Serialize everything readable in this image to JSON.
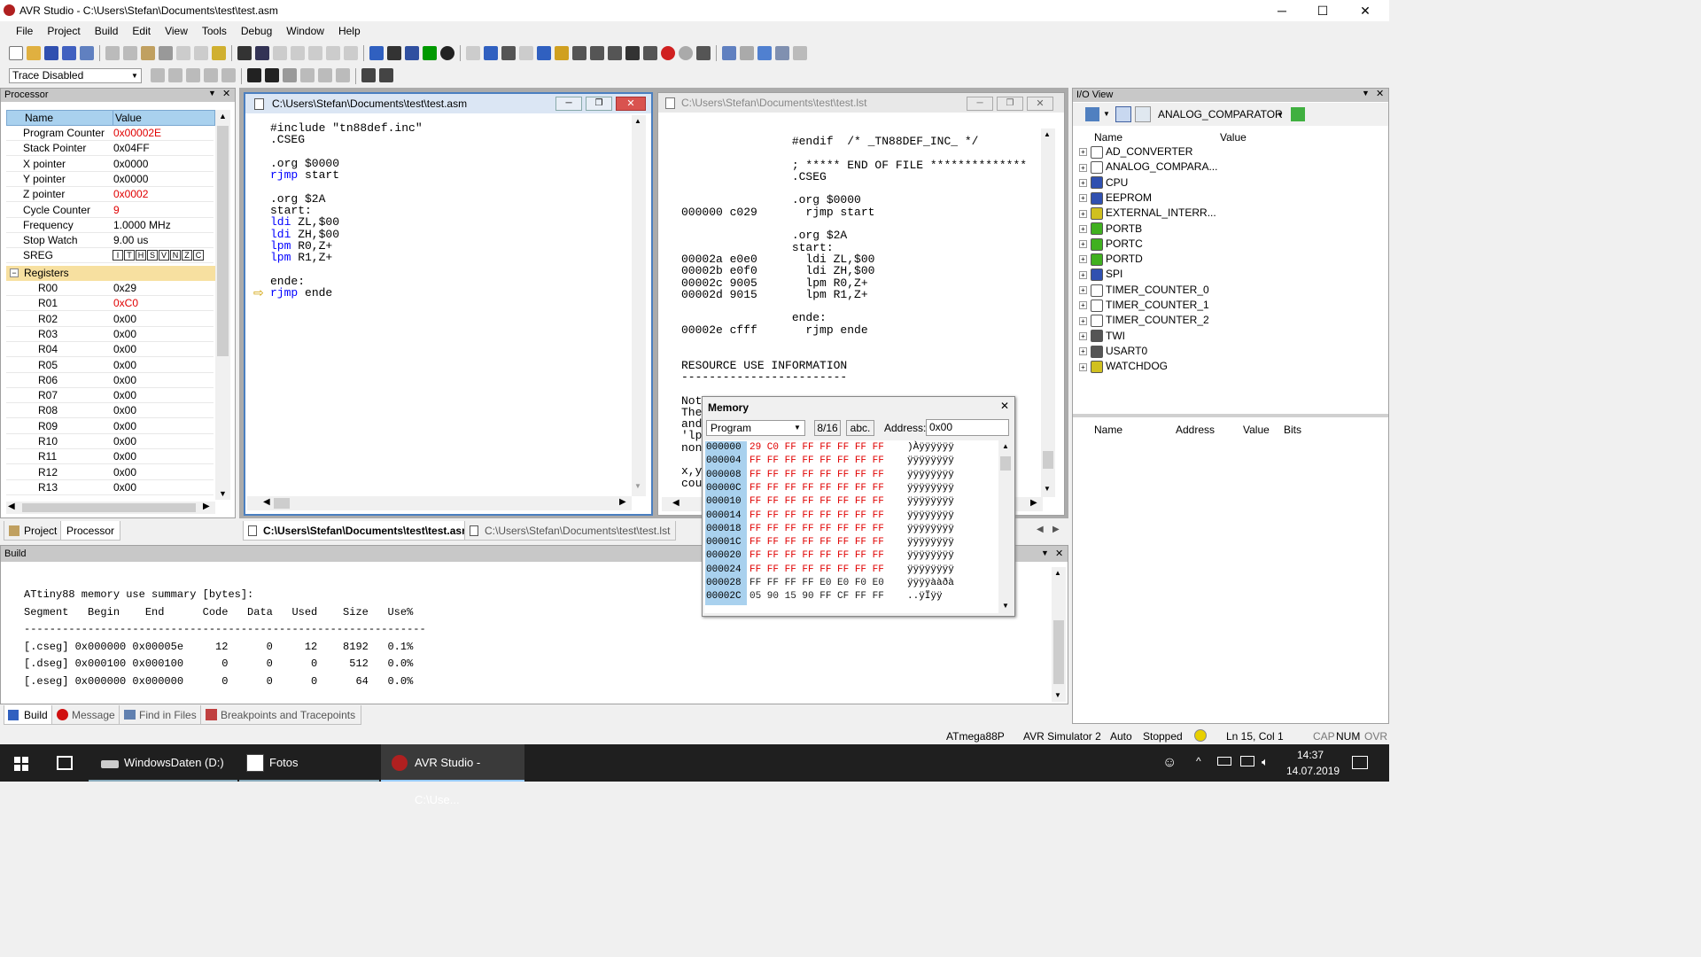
{
  "window": {
    "title": "AVR Studio - C:\\Users\\Stefan\\Documents\\test\\test.asm",
    "minimize": "─",
    "maximize": "☐",
    "close": "✕"
  },
  "menu": [
    "File",
    "Project",
    "Build",
    "Edit",
    "View",
    "Tools",
    "Debug",
    "Window",
    "Help"
  ],
  "trace": {
    "value": "Trace Disabled"
  },
  "processor": {
    "title": "Processor",
    "col_name": "Name",
    "col_value": "Value",
    "rows": [
      {
        "name": "Program Counter",
        "value": "0x00002E",
        "changed": true
      },
      {
        "name": "Stack Pointer",
        "value": "0x04FF",
        "changed": false
      },
      {
        "name": "X pointer",
        "value": "0x0000",
        "changed": false
      },
      {
        "name": "Y pointer",
        "value": "0x0000",
        "changed": false
      },
      {
        "name": "Z pointer",
        "value": "0x0002",
        "changed": true
      },
      {
        "name": "Cycle Counter",
        "value": "9",
        "changed": true
      },
      {
        "name": "Frequency",
        "value": "1.0000 MHz",
        "changed": false
      },
      {
        "name": "Stop Watch",
        "value": "9.00 us",
        "changed": false
      },
      {
        "name": "SREG",
        "value": "ITHSVNZC",
        "changed": false
      }
    ],
    "registers_label": "Registers",
    "registers": [
      {
        "name": "R00",
        "value": "0x29",
        "changed": false
      },
      {
        "name": "R01",
        "value": "0xC0",
        "changed": true
      },
      {
        "name": "R02",
        "value": "0x00",
        "changed": false
      },
      {
        "name": "R03",
        "value": "0x00",
        "changed": false
      },
      {
        "name": "R04",
        "value": "0x00",
        "changed": false
      },
      {
        "name": "R05",
        "value": "0x00",
        "changed": false
      },
      {
        "name": "R06",
        "value": "0x00",
        "changed": false
      },
      {
        "name": "R07",
        "value": "0x00",
        "changed": false
      },
      {
        "name": "R08",
        "value": "0x00",
        "changed": false
      },
      {
        "name": "R09",
        "value": "0x00",
        "changed": false
      },
      {
        "name": "R10",
        "value": "0x00",
        "changed": false
      },
      {
        "name": "R11",
        "value": "0x00",
        "changed": false
      },
      {
        "name": "R12",
        "value": "0x00",
        "changed": false
      },
      {
        "name": "R13",
        "value": "0x00",
        "changed": false
      }
    ]
  },
  "left_tabs": [
    "Project",
    "Processor"
  ],
  "asm_window": {
    "title": "C:\\Users\\Stefan\\Documents\\test\\test.asm",
    "lines": [
      "#include \"tn88def.inc\"",
      ".CSEG",
      "",
      ".org $0000",
      "rjmp start",
      "",
      ".org $2A",
      "start:",
      "ldi ZL,$00",
      "ldi ZH,$00",
      "lpm R0,Z+",
      "lpm R1,Z+",
      "",
      "ende:",
      "rjmp ende"
    ]
  },
  "lst_window": {
    "title": "C:\\Users\\Stefan\\Documents\\test\\test.lst",
    "lines": [
      "                #endif  /* _TN88DEF_INC_ */",
      "",
      "                ; ***** END OF FILE **************",
      "                .CSEG",
      "",
      "                .org $0000",
      "000000 c029       rjmp start",
      "",
      "                .org $2A",
      "                start:",
      "00002a e0e0       ldi ZL,$00",
      "00002b e0f0       ldi ZH,$00",
      "00002c 9005       lpm R0,Z+",
      "00002d 9015       lpm R1,Z+",
      "",
      "                ende:",
      "00002e cfff       rjmp ende",
      "",
      "",
      "RESOURCE USE INFORMATION",
      "------------------------",
      "",
      "Not",
      "The",
      "and",
      "'lp",
      "non",
      "",
      "x,y",
      "cou"
    ]
  },
  "doc_tabs": [
    "C:\\Users\\Stefan\\Documents\\test\\test.asm",
    "C:\\Users\\Stefan\\Documents\\test\\test.lst"
  ],
  "memory": {
    "title": "Memory",
    "type": "Program",
    "width": "8/16",
    "abc": "abc.",
    "address_label": "Address:",
    "address": "0x00",
    "rows": [
      {
        "addr": "000000",
        "bytes": "29 C0 FF FF FF FF FF FF",
        "ascii": ")Àÿÿÿÿÿÿ"
      },
      {
        "addr": "000004",
        "bytes": "FF FF FF FF FF FF FF FF",
        "ascii": "ÿÿÿÿÿÿÿÿ"
      },
      {
        "addr": "000008",
        "bytes": "FF FF FF FF FF FF FF FF",
        "ascii": "ÿÿÿÿÿÿÿÿ"
      },
      {
        "addr": "00000C",
        "bytes": "FF FF FF FF FF FF FF FF",
        "ascii": "ÿÿÿÿÿÿÿÿ"
      },
      {
        "addr": "000010",
        "bytes": "FF FF FF FF FF FF FF FF",
        "ascii": "ÿÿÿÿÿÿÿÿ"
      },
      {
        "addr": "000014",
        "bytes": "FF FF FF FF FF FF FF FF",
        "ascii": "ÿÿÿÿÿÿÿÿ"
      },
      {
        "addr": "000018",
        "bytes": "FF FF FF FF FF FF FF FF",
        "ascii": "ÿÿÿÿÿÿÿÿ"
      },
      {
        "addr": "00001C",
        "bytes": "FF FF FF FF FF FF FF FF",
        "ascii": "ÿÿÿÿÿÿÿÿ"
      },
      {
        "addr": "000020",
        "bytes": "FF FF FF FF FF FF FF FF",
        "ascii": "ÿÿÿÿÿÿÿÿ"
      },
      {
        "addr": "000024",
        "bytes": "FF FF FF FF FF FF FF FF",
        "ascii": "ÿÿÿÿÿÿÿÿ"
      },
      {
        "addr": "000028",
        "bytes": "FF FF FF FF E0 E0 F0 E0",
        "ascii": "ÿÿÿÿààðà"
      },
      {
        "addr": "00002C",
        "bytes": "05 90 15 90 FF CF FF FF",
        "ascii": "..ÿÏÿÿ"
      }
    ]
  },
  "build": {
    "title": "Build",
    "lines": [
      "ATtiny88 memory use summary [bytes]:",
      "Segment   Begin    End      Code   Data   Used    Size   Use%",
      "---------------------------------------------------------------",
      "[.cseg] 0x000000 0x00005e     12      0     12    8192   0.1%",
      "[.dseg] 0x000100 0x000100      0      0      0     512   0.0%",
      "[.eseg] 0x000000 0x000000      0      0      0      64   0.0%"
    ]
  },
  "bottom_tabs": [
    "Build",
    "Message",
    "Find in Files",
    "Breakpoints and Tracepoints"
  ],
  "io": {
    "title": "I/O View",
    "selected": "ANALOG_COMPARATOR",
    "col_name": "Name",
    "col_value": "Value",
    "items": [
      "AD_CONVERTER",
      "ANALOG_COMPARA...",
      "CPU",
      "EEPROM",
      "EXTERNAL_INTERR...",
      "PORTB",
      "PORTC",
      "PORTD",
      "SPI",
      "TIMER_COUNTER_0",
      "TIMER_COUNTER_1",
      "TIMER_COUNTER_2",
      "TWI",
      "USART0",
      "WATCHDOG"
    ],
    "cols2": [
      "Name",
      "Address",
      "Value",
      "Bits"
    ]
  },
  "status": {
    "device": "ATmega88P",
    "sim": "AVR Simulator 2",
    "auto": "Auto",
    "state": "Stopped",
    "pos": "Ln 15, Col 1",
    "cap": "CAP",
    "num": "NUM",
    "ovr": "OVR"
  },
  "taskbar": {
    "items": [
      "WindowsDaten (D:)",
      "Fotos",
      "AVR Studio - C:\\Use..."
    ],
    "time": "14:37",
    "date": "14.07.2019"
  }
}
